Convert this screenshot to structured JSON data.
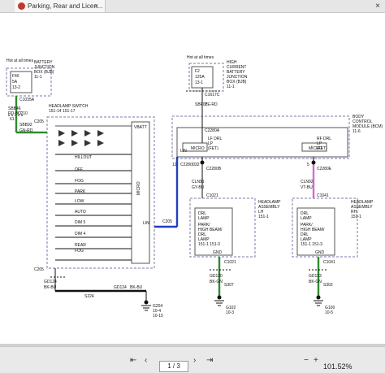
{
  "window": {
    "tab_title": "Parking, Rear and Licen...",
    "tab_close": "×",
    "window_close": "×"
  },
  "toolbar": {
    "prev_page": "‹",
    "next_page": "›",
    "first_page": "⇤",
    "last_page": "⇥",
    "page_value": "1 / 3",
    "zoom_out": "−",
    "zoom_in": "+",
    "zoom": "101.52%"
  },
  "diagram": {
    "colors": {
      "wire": "#111111",
      "blue": "#1f3fbf",
      "violet": "#7b3fbf",
      "green": "#2e8b2e",
      "box": "#7a7aa8",
      "pink": "#d36bd3"
    },
    "left_hot": "Hot at all times",
    "bjb_fuse": [
      "F46",
      "5A",
      "13-2"
    ],
    "bjb_label": [
      "BATTERY",
      "JUNCTION",
      "BOX (BJB)",
      "11-1"
    ],
    "right_hot": "Hot at all times",
    "hcbjb_fuse": [
      "F2",
      "125A",
      "13-1"
    ],
    "hcbjb_label": [
      "HIGH",
      "CURRENT",
      "BATTERY",
      "JUNCTION",
      "BOX (BJB)",
      "11-1"
    ],
    "c1035a": "C1035A",
    "sbb46": "SBB46",
    "wire_color_rdbu": "RD-BU",
    "c210": "C210",
    "c210_pin": "61",
    "sbb92": "SBB92",
    "gnrd": "GN-RD",
    "c1617c": "C1617C",
    "sbf02": "SBF02",
    "ye_rd": "YE-RD",
    "c2280a": "C2280A",
    "hs_label": [
      "HEADLAMP SWITCH",
      "151-14  151-17"
    ],
    "c205_top": "C205",
    "vbatt": "VBATT",
    "hillout": "HILLOUT",
    "sw_off": "OFF",
    "sw_fog": "FOG",
    "sw_park": "PARK",
    "sw_low": "LOW",
    "sw_auto": "AUTO",
    "sw_dim5": "DIM 5",
    "sw_dim4": "DIM 4",
    "sw_rear": "REAR",
    "sw_fog2": "FOG",
    "micro": "MICRO",
    "lin": "LIN",
    "lin_bcm": "LIN",
    "c205_lin": "C205",
    "lin_pin": "12",
    "c2280d": "C2280D",
    "bcm_label": [
      "BODY",
      "CONTROL",
      "MODULE (BCM)",
      "11-6"
    ],
    "micro_left": "MICRO",
    "micro_right": "MICRO",
    "lf_drl": [
      "LF DRL",
      "LP",
      "(FET)"
    ],
    "rf_drl": [
      "RF DRL",
      "LP",
      "(FET)"
    ],
    "left_pin": "32",
    "right_pin": "5",
    "c2280b": "C2280B",
    "c2280e": "C2280E",
    "cln91": "CLN91",
    "cln91_col": "GY-BU",
    "cln92": "CLN92",
    "cln92_col": "VT-BU",
    "c1021": "C1021",
    "c1041": "C1041",
    "lh_lamp": [
      "HEADLAMP",
      "ASSEMBLY",
      "LH",
      "151-1"
    ],
    "rh_lamp": [
      "HEADLAMP",
      "ASSEMBLY",
      "RH",
      "151-1"
    ],
    "lh_inner": [
      "DRL",
      "LAMP",
      "",
      "PARK/",
      "HIGH BEAM/",
      "DRL",
      "LAMP",
      "151-1  151-3"
    ],
    "rh_inner": [
      "DRL",
      "LAMP",
      "",
      "PARK/",
      "HIGH BEAM/",
      "DRL",
      "LAMP",
      "151-1  151-3"
    ],
    "gnd": "GND",
    "c1021_b": "C1021",
    "c1041_b": "C1041",
    "gd120": "GD120",
    "gd120_col": "BK-GN",
    "gd123": "GD123",
    "gd123_col": "BK-GN",
    "s307": "S307",
    "s302": "S302",
    "g102": [
      "G102",
      "10-3"
    ],
    "g100": [
      "G100",
      "10-5"
    ],
    "c205_bot": "C205",
    "gd124": "GD124",
    "gd124_col": "BK-BU",
    "gd124b": "GD124",
    "bkbu": "BK-BU",
    "s224": "S224",
    "g204": [
      "G204",
      "10-4",
      "10-15"
    ]
  }
}
